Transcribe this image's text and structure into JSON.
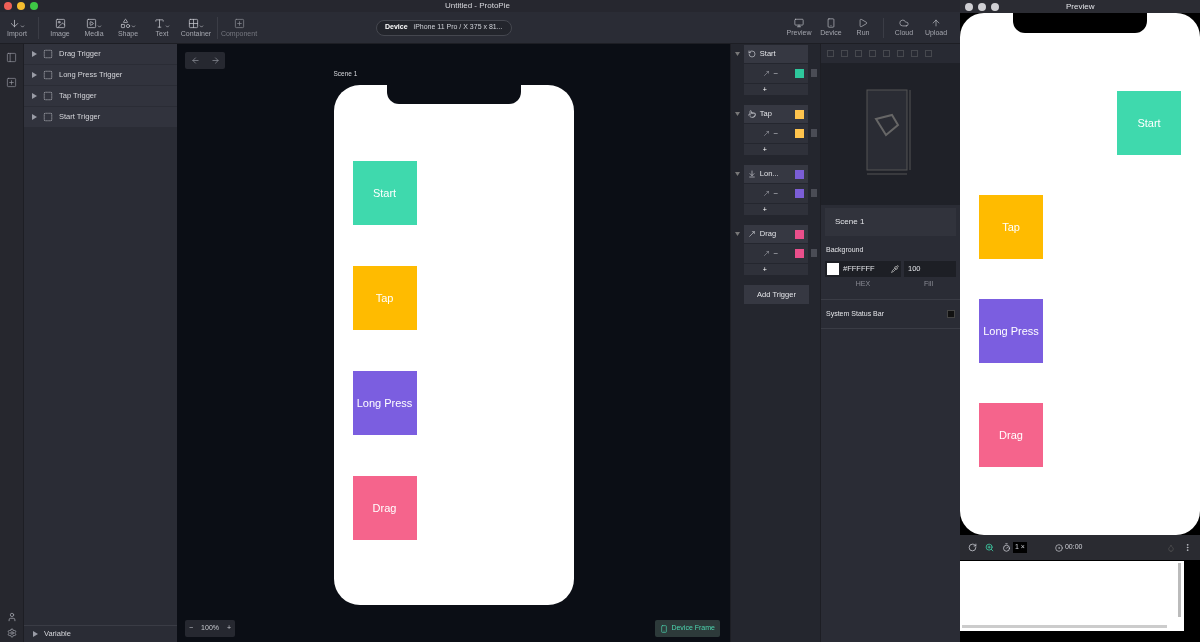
{
  "window": {
    "title": "Untitled - ProtoPie"
  },
  "toolbar": {
    "tools": [
      {
        "kind": "import",
        "label": "Import",
        "disabled": false,
        "menu": true
      },
      {
        "kind": "image",
        "label": "Image",
        "disabled": false,
        "menu": false
      },
      {
        "kind": "media",
        "label": "Media",
        "disabled": false,
        "menu": true
      },
      {
        "kind": "shape",
        "label": "Shape",
        "disabled": false,
        "menu": true
      },
      {
        "kind": "text",
        "label": "Text",
        "disabled": false,
        "menu": true
      },
      {
        "kind": "container",
        "label": "Container",
        "disabled": false,
        "menu": true
      },
      {
        "kind": "component",
        "label": "Component",
        "disabled": true,
        "menu": false
      }
    ],
    "device": {
      "label": "Device",
      "value": "iPhone 11 Pro / X  375 x 81..."
    },
    "right_tools": [
      {
        "kind": "preview",
        "label": "Preview"
      },
      {
        "kind": "device",
        "label": "Device"
      },
      {
        "kind": "run",
        "label": "Run"
      },
      {
        "kind": "cloud",
        "label": "Cloud"
      },
      {
        "kind": "upload",
        "label": "Upload"
      }
    ]
  },
  "layers": {
    "items": [
      {
        "label": "Drag Trigger"
      },
      {
        "label": "Long Press Trigger"
      },
      {
        "label": "Tap Trigger"
      },
      {
        "label": "Start Trigger"
      }
    ],
    "variable": "Variable"
  },
  "canvas": {
    "scene_label": "Scene 1",
    "zoom": {
      "minus": "−",
      "value": "100%",
      "plus": "+"
    },
    "device_frame": "Device Frame",
    "phone_layers": [
      {
        "label": "Start",
        "color": "#3fd9ad"
      },
      {
        "label": "Tap",
        "color": "#ffbb00"
      },
      {
        "label": "Long Press",
        "color": "#7b5ee0"
      },
      {
        "label": "Drag",
        "color": "#f5648c"
      }
    ]
  },
  "triggers": {
    "items": [
      {
        "kind": "start",
        "label": "Start",
        "response": {
          "dash": "–",
          "color": "#2ec79c"
        },
        "add": "+"
      },
      {
        "kind": "tap",
        "label": "Tap",
        "color": "#ffc44d",
        "response": {
          "dash": "–",
          "color": "#ffc44d"
        },
        "add": "+"
      },
      {
        "kind": "long_press",
        "label": "Lon...",
        "color": "#7b5ed6",
        "response": {
          "dash": "–",
          "color": "#7b5ed6"
        },
        "add": "+"
      },
      {
        "kind": "drag",
        "label": "Drag",
        "color": "#ea4f8b",
        "response": {
          "dash": "–",
          "color": "#ea4f8b"
        },
        "add": "+"
      }
    ],
    "add_trigger": "Add Trigger"
  },
  "properties": {
    "scene_name": "Scene 1",
    "background_label": "Background",
    "hex": "#FFFFFF",
    "hex_caption": "HEX",
    "fill": "100",
    "fill_caption": "Fill",
    "status_bar_label": "System Status Bar",
    "status_bar_checked": false
  },
  "preview": {
    "title": "Preview",
    "items": [
      {
        "label": "Start",
        "color": "#3fd9ad",
        "kind": "right"
      },
      {
        "label": "Tap",
        "color": "#ffbb00",
        "kind": "left"
      },
      {
        "label": "Long Press",
        "color": "#7b5ee0",
        "kind": "left"
      },
      {
        "label": "Drag",
        "color": "#f5648c",
        "kind": "left"
      }
    ],
    "speed": "1 ×",
    "timer": "00:00"
  }
}
